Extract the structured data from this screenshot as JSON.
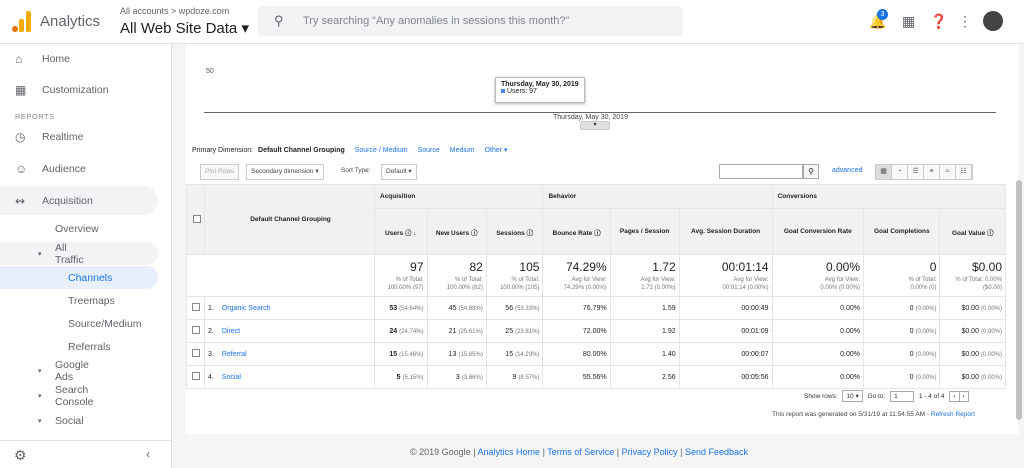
{
  "header": {
    "app_name": "Analytics",
    "account_crumb": "All accounts > wpdoze.com",
    "property": "All Web Site Data ▾",
    "search_placeholder": "Try searching “Any anomalies in sessions this month?”",
    "notification_count": "3"
  },
  "sidebar": {
    "home": "Home",
    "customization": "Customization",
    "section": "REPORTS",
    "realtime": "Realtime",
    "audience": "Audience",
    "acquisition": "Acquisition",
    "overview": "Overview",
    "all_traffic": "All Traffic",
    "channels": "Channels",
    "treemaps": "Treemaps",
    "source_medium": "Source/Medium",
    "referrals": "Referrals",
    "google_ads": "Google Ads",
    "search_console": "Search Console",
    "social": "Social"
  },
  "chart": {
    "y_tick": "50",
    "tooltip_date": "Thursday, May 30, 2019",
    "tooltip_value": "Users: 97",
    "x_label": "Thursday, May 30, 2019"
  },
  "dimension_bar": {
    "label": "Primary Dimension:",
    "current": "Default Channel Grouping",
    "options": [
      "Source / Medium",
      "Source",
      "Medium",
      "Other ▾"
    ]
  },
  "tools": {
    "plot_rows": "Plot Rows",
    "secondary": "Secondary dimension ▾",
    "sort_label": "Sort Type:",
    "sort_value": "Default ▾",
    "advanced": "advanced"
  },
  "table": {
    "groups": [
      "Acquisition",
      "Behavior",
      "Conversions"
    ],
    "dimension_header": "Default Channel Grouping",
    "columns": [
      "Users",
      "New Users",
      "Sessions",
      "Bounce Rate",
      "Pages / Session",
      "Avg. Session Duration",
      "Goal Conversion Rate",
      "Goal Completions",
      "Goal Value"
    ],
    "totals": [
      {
        "big": "97",
        "l1": "% of Total:",
        "l2": "100.00% (97)"
      },
      {
        "big": "82",
        "l1": "% of Total:",
        "l2": "100.00% (82)"
      },
      {
        "big": "105",
        "l1": "% of Total:",
        "l2": "100.00% (105)"
      },
      {
        "big": "74.29%",
        "l1": "Avg for View:",
        "l2": "74.29% (0.00%)"
      },
      {
        "big": "1.72",
        "l1": "Avg for View:",
        "l2": "1.72 (0.00%)"
      },
      {
        "big": "00:01:14",
        "l1": "Avg for View:",
        "l2": "00:01:14 (0.00%)"
      },
      {
        "big": "0.00%",
        "l1": "Avg for View:",
        "l2": "0.00% (0.00%)"
      },
      {
        "big": "0",
        "l1": "% of Total:",
        "l2": "0.00% (0)"
      },
      {
        "big": "$0.00",
        "l1": "% of Total: 0.00%",
        "l2": "($0.00)"
      }
    ],
    "rows": [
      {
        "idx": "1.",
        "name": "Organic Search",
        "users": "53",
        "users_pct": "(54.64%)",
        "new": "45",
        "new_pct": "(54.88%)",
        "sess": "56",
        "sess_pct": "(53.33%)",
        "bounce": "76.79%",
        "pps": "1.59",
        "dur": "00:00:49",
        "gcr": "0.00%",
        "gc": "0",
        "gc_pct": "(0.00%)",
        "gv": "$0.00",
        "gv_pct": "(0.00%)"
      },
      {
        "idx": "2.",
        "name": "Direct",
        "users": "24",
        "users_pct": "(24.74%)",
        "new": "21",
        "new_pct": "(25.61%)",
        "sess": "25",
        "sess_pct": "(23.81%)",
        "bounce": "72.00%",
        "pps": "1.92",
        "dur": "00:01:09",
        "gcr": "0.00%",
        "gc": "0",
        "gc_pct": "(0.00%)",
        "gv": "$0.00",
        "gv_pct": "(0.00%)"
      },
      {
        "idx": "3.",
        "name": "Referral",
        "users": "15",
        "users_pct": "(15.46%)",
        "new": "13",
        "new_pct": "(15.85%)",
        "sess": "15",
        "sess_pct": "(14.29%)",
        "bounce": "80.00%",
        "pps": "1.40",
        "dur": "00:00:07",
        "gcr": "0.00%",
        "gc": "0",
        "gc_pct": "(0.00%)",
        "gv": "$0.00",
        "gv_pct": "(0.00%)"
      },
      {
        "idx": "4.",
        "name": "Social",
        "users": "5",
        "users_pct": "(5.15%)",
        "new": "3",
        "new_pct": "(3.66%)",
        "sess": "9",
        "sess_pct": "(8.57%)",
        "bounce": "55.56%",
        "pps": "2.56",
        "dur": "00:05:56",
        "gcr": "0.00%",
        "gc": "0",
        "gc_pct": "(0.00%)",
        "gv": "$0.00",
        "gv_pct": "(0.00%)"
      }
    ]
  },
  "pager": {
    "show_rows": "Show rows:",
    "rows_value": "10 ▾",
    "goto": "Go to:",
    "goto_value": "1",
    "range": "1 - 4 of 4"
  },
  "generated": {
    "text": "This report was generated on 5/31/19 at 11:54:55 AM - ",
    "refresh": "Refresh Report"
  },
  "footer": {
    "copyright": "© 2019 Google",
    "links": [
      "Analytics Home",
      "Terms of Service",
      "Privacy Policy",
      "Send Feedback"
    ]
  },
  "colors": {
    "accent": "#1a73e8",
    "logo_orange": "#f9ab00",
    "logo_dark": "#e37400"
  }
}
